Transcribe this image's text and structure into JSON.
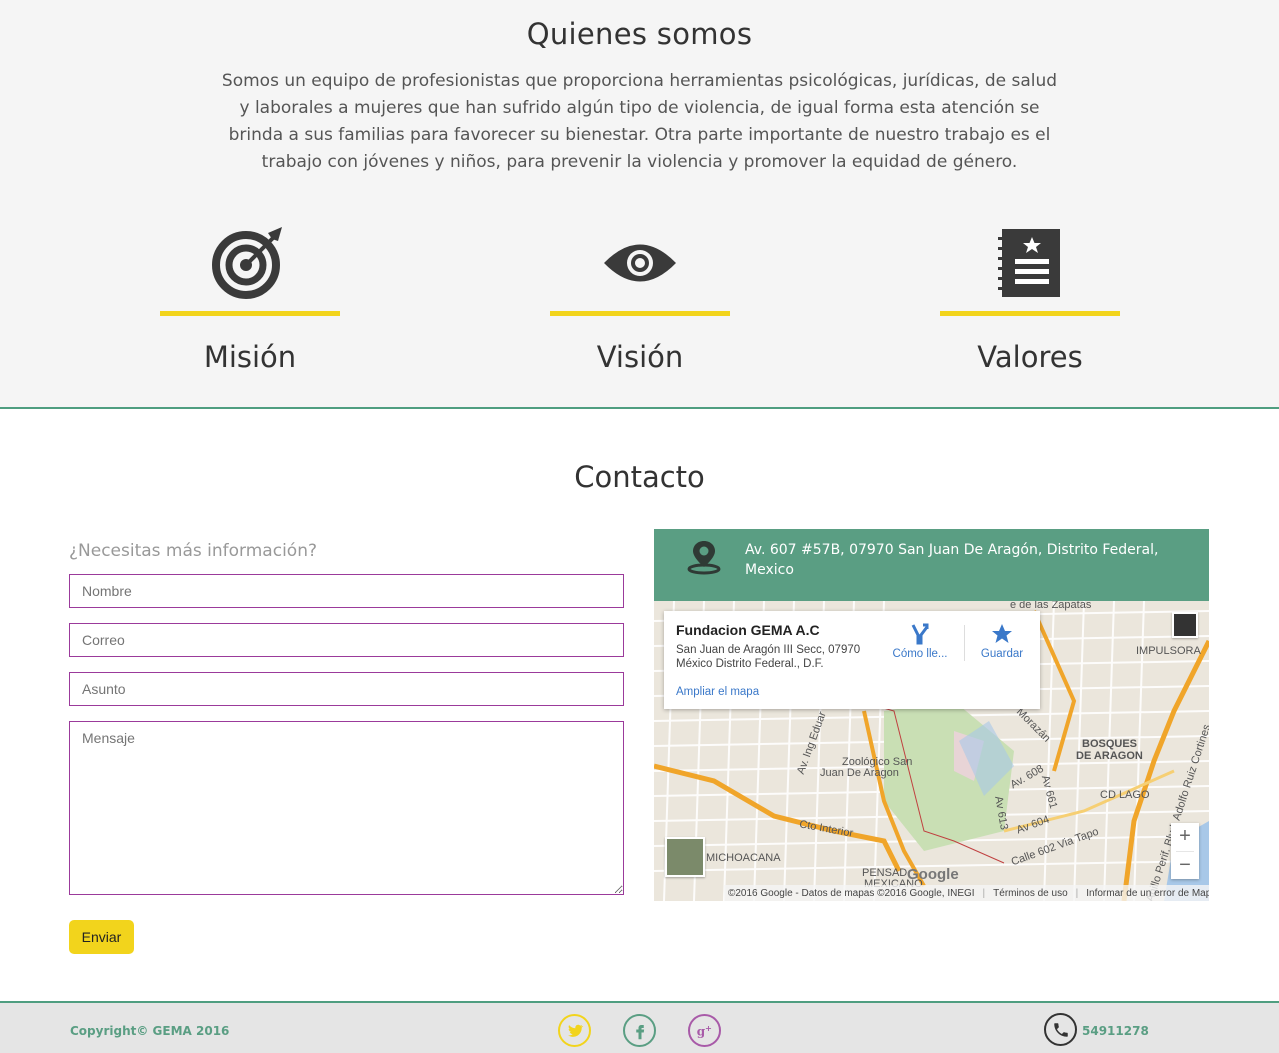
{
  "about": {
    "title": "Quienes somos",
    "text": "Somos un equipo de profesionistas que proporciona herramientas psicológicas, jurídicas, de salud y laborales a mujeres que han sufrido algún tipo de violencia, de igual forma esta atención se brinda a sus familias para favorecer su bienestar. Otra parte importante de nuestro trabajo es el trabajo con jóvenes y niños, para prevenir la violencia y promover la equidad de género.",
    "pillars": [
      {
        "label": "Misión",
        "icon": "target-icon"
      },
      {
        "label": "Visión",
        "icon": "eye-icon"
      },
      {
        "label": "Valores",
        "icon": "notebook-icon"
      }
    ],
    "accent": "#f2d41c"
  },
  "contact": {
    "title": "Contacto",
    "form_title": "¿Necesitas más información?",
    "fields": {
      "name_placeholder": "Nombre",
      "email_placeholder": "Correo",
      "subject_placeholder": "Asunto",
      "message_placeholder": "Mensaje"
    },
    "send_label": "Enviar",
    "address": "Av. 607 #57B, 07970 San Juan De Aragón, Distrito Federal, Mexico",
    "map": {
      "place_name": "Fundacion GEMA A.C",
      "place_line1": "San Juan de Aragón III Secc, 07970",
      "place_line2": "México Distrito Federal., D.F.",
      "enlarge_label": "Ampliar el mapa",
      "directions_label": "Cómo lle...",
      "save_label": "Guardar",
      "labels": {
        "impulsora": "IMPULSORA",
        "bosques1": "BOSQUES",
        "bosques2": "DE ARAGON",
        "cdlago": "CD LAGO",
        "zoo1": "Zoológico San",
        "zoo2": "Juan De Aragon",
        "michoacana": "MICHOACANA",
        "pensador": "PENSAD",
        "mexicano": "MEXICANO",
        "zapatas": "e de las Zapatas",
        "morazan": "o Morazán",
        "av608": "Av. 608",
        "av661": "Av 661",
        "av613": "Av 613",
        "av604": "Av 604",
        "calle602": "Calle 602 Via Tapo",
        "ingeduard": "Av. Ing Eduar",
        "cto": "Cto Interior",
        "anillo": "Anillo Perif. Blvd. Adolfo Ruiz Cortines"
      },
      "attribution": "©2016 Google - Datos de mapas ©2016 Google, INEGI",
      "terms": "Términos de uso",
      "report": "Informar de un error de Maps",
      "zoom_in": "+",
      "zoom_out": "−",
      "google": "Google"
    }
  },
  "footer": {
    "copyright": "Copyright© GEMA 2016",
    "phone": "54911278"
  },
  "colors": {
    "green": "#5a9e83",
    "yellow": "#f2d41c",
    "purple": "#a85aa8"
  }
}
